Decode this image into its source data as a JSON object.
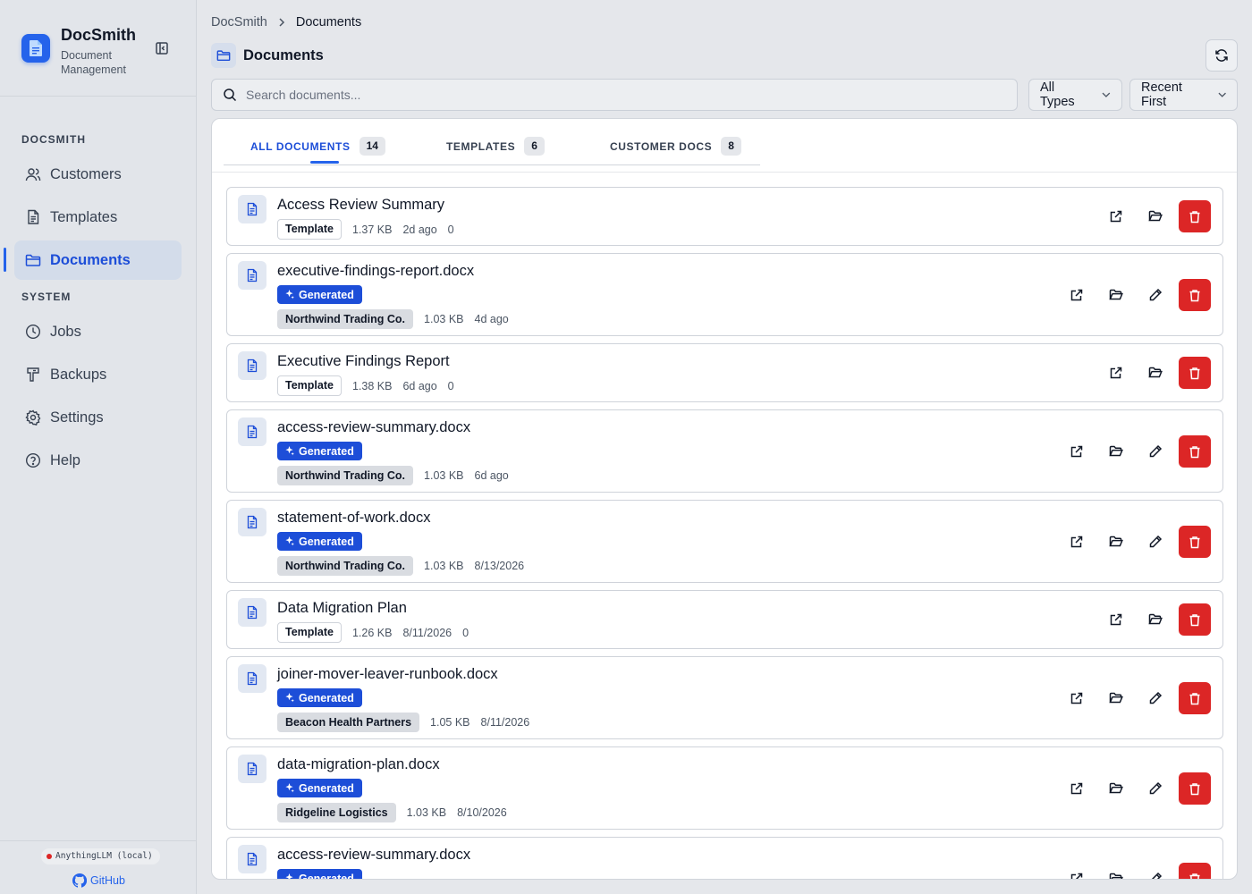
{
  "app": {
    "name": "DocSmith",
    "subtitle": "Document Management"
  },
  "sidebar": {
    "section1": "DOCSMITH",
    "section2": "SYSTEM",
    "items": [
      {
        "label": "Customers",
        "icon": "users-icon"
      },
      {
        "label": "Templates",
        "icon": "file-text-icon"
      },
      {
        "label": "Documents",
        "icon": "folder-icon",
        "active": true
      },
      {
        "label": "Jobs",
        "icon": "clock-icon"
      },
      {
        "label": "Backups",
        "icon": "database-icon"
      },
      {
        "label": "Settings",
        "icon": "gear-icon"
      },
      {
        "label": "Help",
        "icon": "help-circle-icon"
      }
    ],
    "status": "AnythingLLM (local)",
    "github": "GitHub"
  },
  "breadcrumb": {
    "root": "DocSmith",
    "current": "Documents"
  },
  "page": {
    "title": "Documents"
  },
  "search": {
    "placeholder": "Search documents...",
    "value": ""
  },
  "filters": {
    "type": "All Types",
    "sort": "Recent First"
  },
  "tabs": [
    {
      "label": "ALL DOCUMENTS",
      "count": "14",
      "active": true
    },
    {
      "label": "TEMPLATES",
      "count": "6"
    },
    {
      "label": "CUSTOMER DOCS",
      "count": "8"
    }
  ],
  "badges": {
    "template": "Template",
    "generated": "Generated"
  },
  "documents": [
    {
      "name": "Access Review Summary",
      "kind": "template",
      "size": "1.37 KB",
      "date": "2d ago",
      "extra": "0"
    },
    {
      "name": "executive-findings-report.docx",
      "kind": "generated",
      "customer": "Northwind Trading Co.",
      "size": "1.03 KB",
      "date": "4d ago"
    },
    {
      "name": "Executive Findings Report",
      "kind": "template",
      "size": "1.38 KB",
      "date": "6d ago",
      "extra": "0"
    },
    {
      "name": "access-review-summary.docx",
      "kind": "generated",
      "customer": "Northwind Trading Co.",
      "size": "1.03 KB",
      "date": "6d ago"
    },
    {
      "name": "statement-of-work.docx",
      "kind": "generated",
      "customer": "Northwind Trading Co.",
      "size": "1.03 KB",
      "date": "8/13/2026"
    },
    {
      "name": "Data Migration Plan",
      "kind": "template",
      "size": "1.26 KB",
      "date": "8/11/2026",
      "extra": "0"
    },
    {
      "name": "joiner-mover-leaver-runbook.docx",
      "kind": "generated",
      "customer": "Beacon Health Partners",
      "size": "1.05 KB",
      "date": "8/11/2026"
    },
    {
      "name": "data-migration-plan.docx",
      "kind": "generated",
      "customer": "Ridgeline Logistics",
      "size": "1.03 KB",
      "date": "8/10/2026"
    },
    {
      "name": "access-review-summary.docx",
      "kind": "generated",
      "customer": "",
      "size": "",
      "date": ""
    }
  ],
  "colors": {
    "accent": "#2563eb",
    "danger": "#dc2626",
    "active_bg": "#d3dcea"
  }
}
